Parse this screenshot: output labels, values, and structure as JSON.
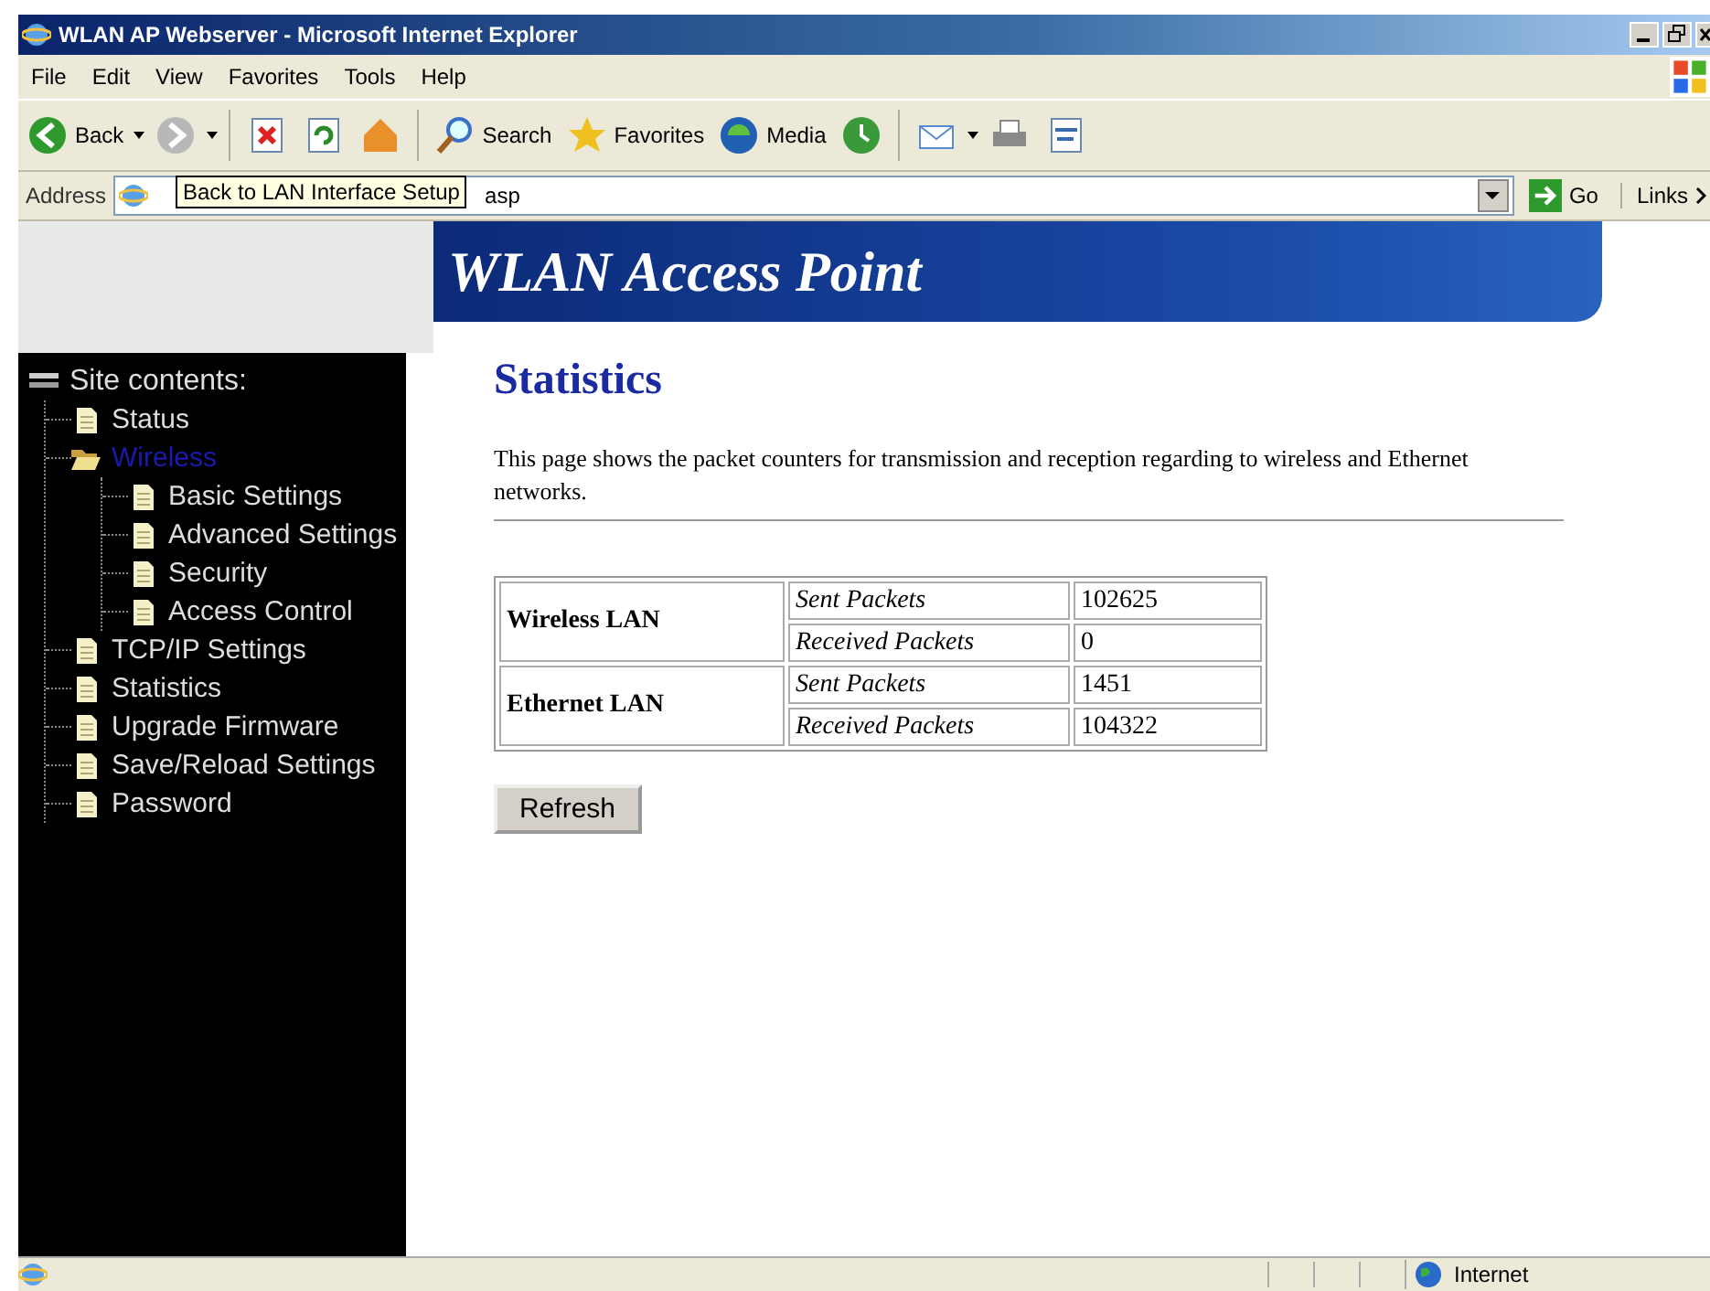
{
  "window": {
    "title": "WLAN AP Webserver - Microsoft Internet Explorer"
  },
  "menu": [
    "File",
    "Edit",
    "View",
    "Favorites",
    "Tools",
    "Help"
  ],
  "toolbar": [
    {
      "kind": "back",
      "label": "Back",
      "dropdown": true
    },
    {
      "kind": "forward",
      "dropdown": true
    },
    {
      "kind": "stop"
    },
    {
      "kind": "refresh"
    },
    {
      "kind": "home"
    },
    {
      "kind": "search",
      "label": "Search"
    },
    {
      "kind": "favorites",
      "label": "Favorites"
    },
    {
      "kind": "media",
      "label": "Media"
    },
    {
      "kind": "history"
    },
    {
      "kind": "mail",
      "dropdown": true
    },
    {
      "kind": "print"
    },
    {
      "kind": "edit"
    }
  ],
  "address": {
    "label": "Address",
    "value": "asp",
    "tooltip": "Back to LAN Interface Setup",
    "go": "Go",
    "links": "Links"
  },
  "banner": {
    "title": "WLAN Access Point"
  },
  "sidebar": {
    "title": "Site contents:",
    "items": [
      {
        "label": "Status",
        "selected": false
      },
      {
        "label": "Wireless",
        "selected": true,
        "expanded": true,
        "children": [
          {
            "label": "Basic Settings",
            "selected": false
          },
          {
            "label": "Advanced Settings",
            "selected": false
          },
          {
            "label": "Security",
            "selected": false
          },
          {
            "label": "Access Control",
            "selected": false
          }
        ]
      },
      {
        "label": "TCP/IP Settings",
        "selected": false
      },
      {
        "label": "Statistics",
        "selected": false
      },
      {
        "label": "Upgrade Firmware",
        "selected": false
      },
      {
        "label": "Save/Reload Settings",
        "selected": false
      },
      {
        "label": "Password",
        "selected": false
      }
    ]
  },
  "page": {
    "heading": "Statistics",
    "description": "This page shows the packet counters for transmission and reception regarding to wireless and Ethernet networks."
  },
  "table": {
    "groups": [
      {
        "name": "Wireless LAN",
        "rows": [
          {
            "label": "Sent Packets",
            "value": "102625"
          },
          {
            "label": "Received Packets",
            "value": "0"
          }
        ]
      },
      {
        "name": "Ethernet LAN",
        "rows": [
          {
            "label": "Sent Packets",
            "value": "1451"
          },
          {
            "label": "Received Packets",
            "value": "104322"
          }
        ]
      }
    ]
  },
  "refresh_button": "Refresh",
  "status_bar": {
    "zone": "Internet"
  }
}
